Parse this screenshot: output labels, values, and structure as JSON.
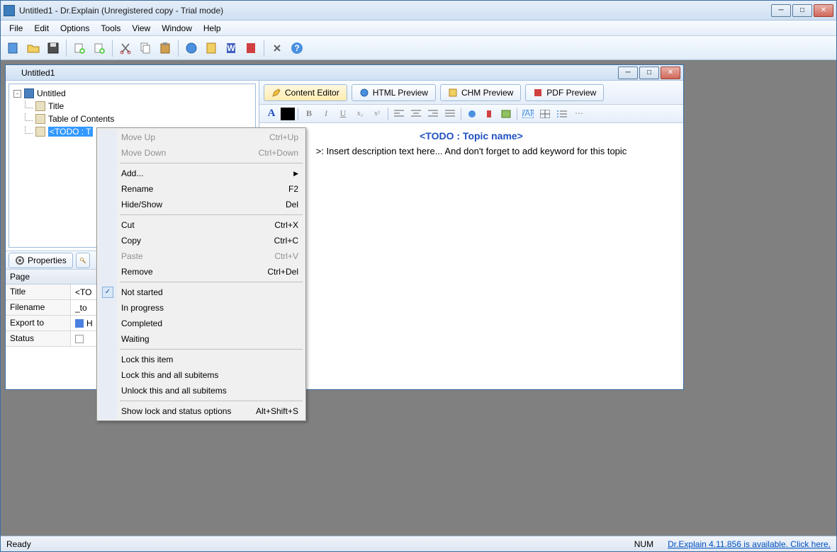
{
  "app_title": "Untitled1 - Dr.Explain (Unregistered copy - Trial mode)",
  "menubar": [
    "File",
    "Edit",
    "Options",
    "Tools",
    "View",
    "Window",
    "Help"
  ],
  "doc_title": "Untitled1",
  "tree": {
    "root": "Untitled",
    "items": [
      "Title",
      "Table of Contents"
    ],
    "selected": "<TODO : T"
  },
  "prop_tab": "Properties",
  "propgrid": {
    "header": "Page",
    "rows": [
      {
        "label": "Title",
        "value": "<TO"
      },
      {
        "label": "Filename",
        "value": "_to"
      },
      {
        "label": "Export to",
        "value": "H"
      },
      {
        "label": "Status",
        "value": ""
      }
    ]
  },
  "view_tabs": [
    "Content Editor",
    "HTML Preview",
    "CHM Preview",
    "PDF Preview"
  ],
  "editor": {
    "title": "<TODO : Topic name>",
    "body": ">: Insert description text here... And don't forget to add keyword for this topic"
  },
  "context_menu": [
    {
      "label": "Move Up",
      "shortcut": "Ctrl+Up",
      "disabled": true
    },
    {
      "label": "Move Down",
      "shortcut": "Ctrl+Down",
      "disabled": true
    },
    {
      "sep": true
    },
    {
      "label": "Add...",
      "submenu": true
    },
    {
      "label": "Rename",
      "shortcut": "F2"
    },
    {
      "label": "Hide/Show",
      "shortcut": "Del"
    },
    {
      "sep": true
    },
    {
      "label": "Cut",
      "shortcut": "Ctrl+X"
    },
    {
      "label": "Copy",
      "shortcut": "Ctrl+C"
    },
    {
      "label": "Paste",
      "shortcut": "Ctrl+V",
      "disabled": true
    },
    {
      "label": "Remove",
      "shortcut": "Ctrl+Del"
    },
    {
      "sep": true
    },
    {
      "label": "Not started",
      "checked": true
    },
    {
      "label": "In progress"
    },
    {
      "label": "Completed"
    },
    {
      "label": "Waiting"
    },
    {
      "sep": true
    },
    {
      "label": "Lock this item"
    },
    {
      "label": "Lock this and all subitems"
    },
    {
      "label": "Unlock this and all subitems"
    },
    {
      "sep": true
    },
    {
      "label": "Show lock and status options",
      "shortcut": "Alt+Shift+S"
    }
  ],
  "status": {
    "left": "Ready",
    "num": "NUM",
    "link": "Dr.Explain 4.11.856 is available. Click here."
  }
}
